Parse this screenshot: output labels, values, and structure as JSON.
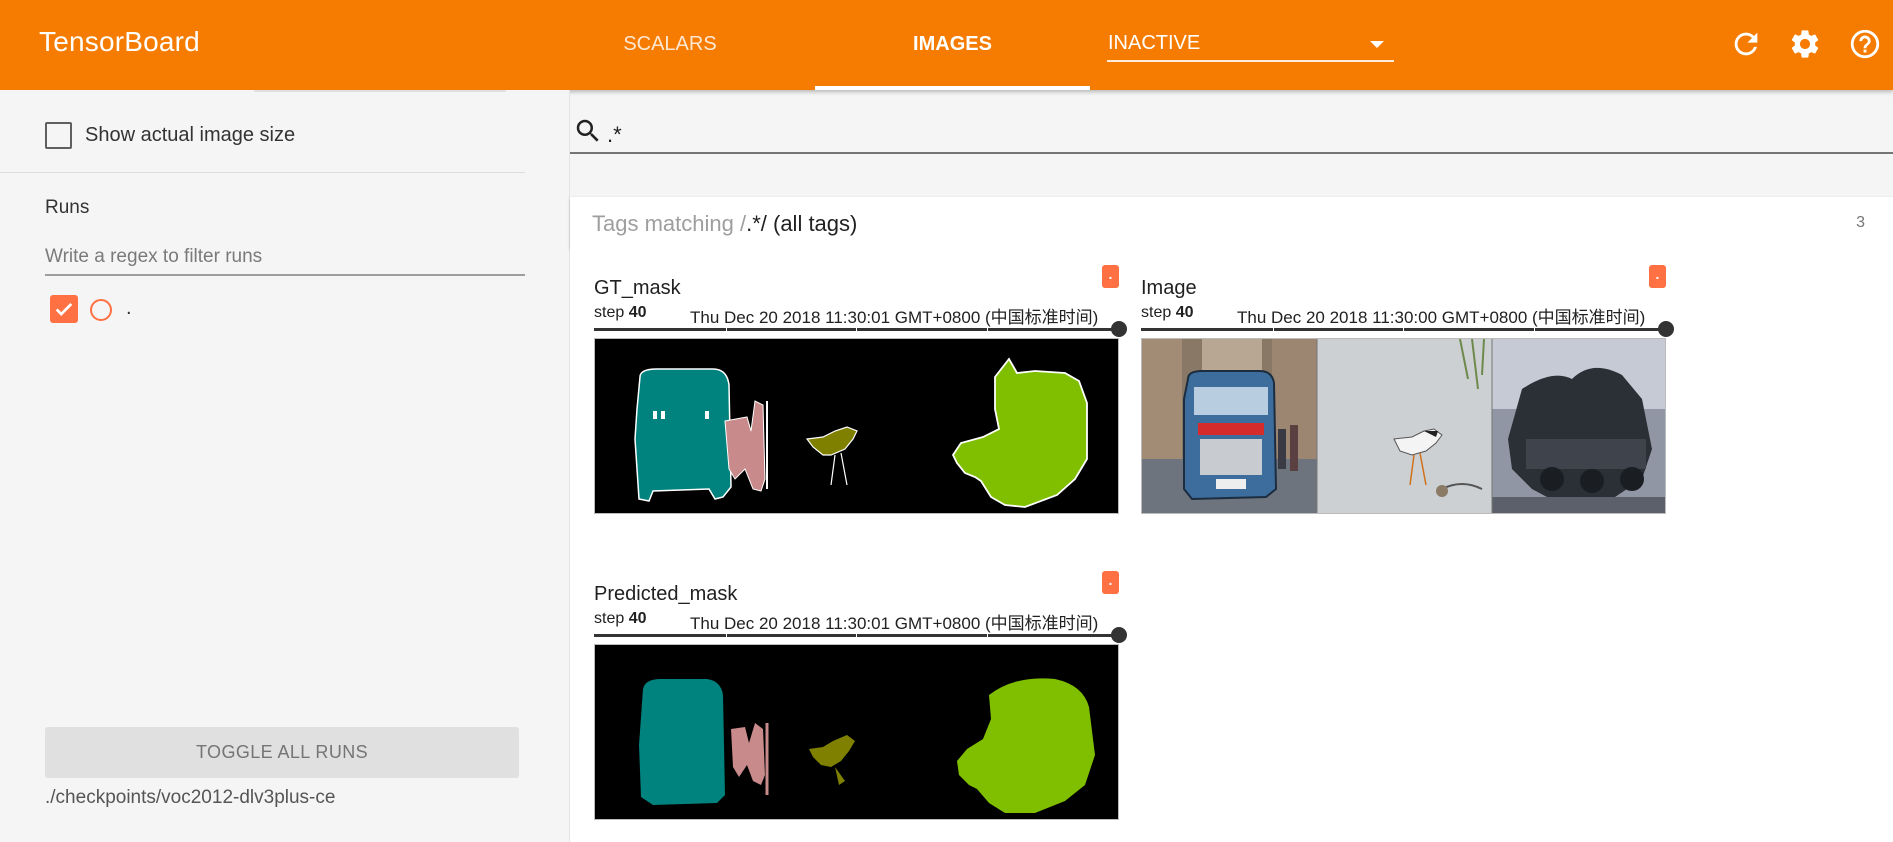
{
  "header": {
    "brand": "TensorBoard",
    "tabs": [
      {
        "label": "SCALARS",
        "active": false
      },
      {
        "label": "IMAGES",
        "active": true
      }
    ],
    "inactive_dropdown": {
      "value": "INACTIVE"
    },
    "icons": [
      "refresh-icon",
      "settings-icon",
      "help-icon"
    ],
    "colors": {
      "toolbar": "#f57c00",
      "accent": "#ff7043"
    }
  },
  "sidebar": {
    "show_actual_size_label": "Show actual image size",
    "show_actual_size_checked": false,
    "runs_title": "Runs",
    "runs_filter_placeholder": "Write a regex to filter runs",
    "runs": [
      {
        "name": ".",
        "checked": true
      }
    ],
    "toggle_all_label": "TOGGLE ALL RUNS",
    "logdir": "./checkpoints/voc2012-dlv3plus-ce"
  },
  "main": {
    "search_value": ".*",
    "tag_group": {
      "prefix": "Tags matching /",
      "pattern": ".*",
      "suffix": "/ (all tags)",
      "count": "3"
    },
    "cards": [
      {
        "title": "GT_mask",
        "run_badge": ".",
        "step_label": "step",
        "step": "40",
        "timestamp": "Thu Dec 20 2018 11:30:01 GMT+0800 (中国标准时间)"
      },
      {
        "title": "Image",
        "run_badge": ".",
        "step_label": "step",
        "step": "40",
        "timestamp": "Thu Dec 20 2018 11:30:00 GMT+0800 (中国标准时间)"
      },
      {
        "title": "Predicted_mask",
        "run_badge": ".",
        "step_label": "step",
        "step": "40",
        "timestamp": "Thu Dec 20 2018 11:30:01 GMT+0800 (中国标准时间)"
      }
    ]
  }
}
